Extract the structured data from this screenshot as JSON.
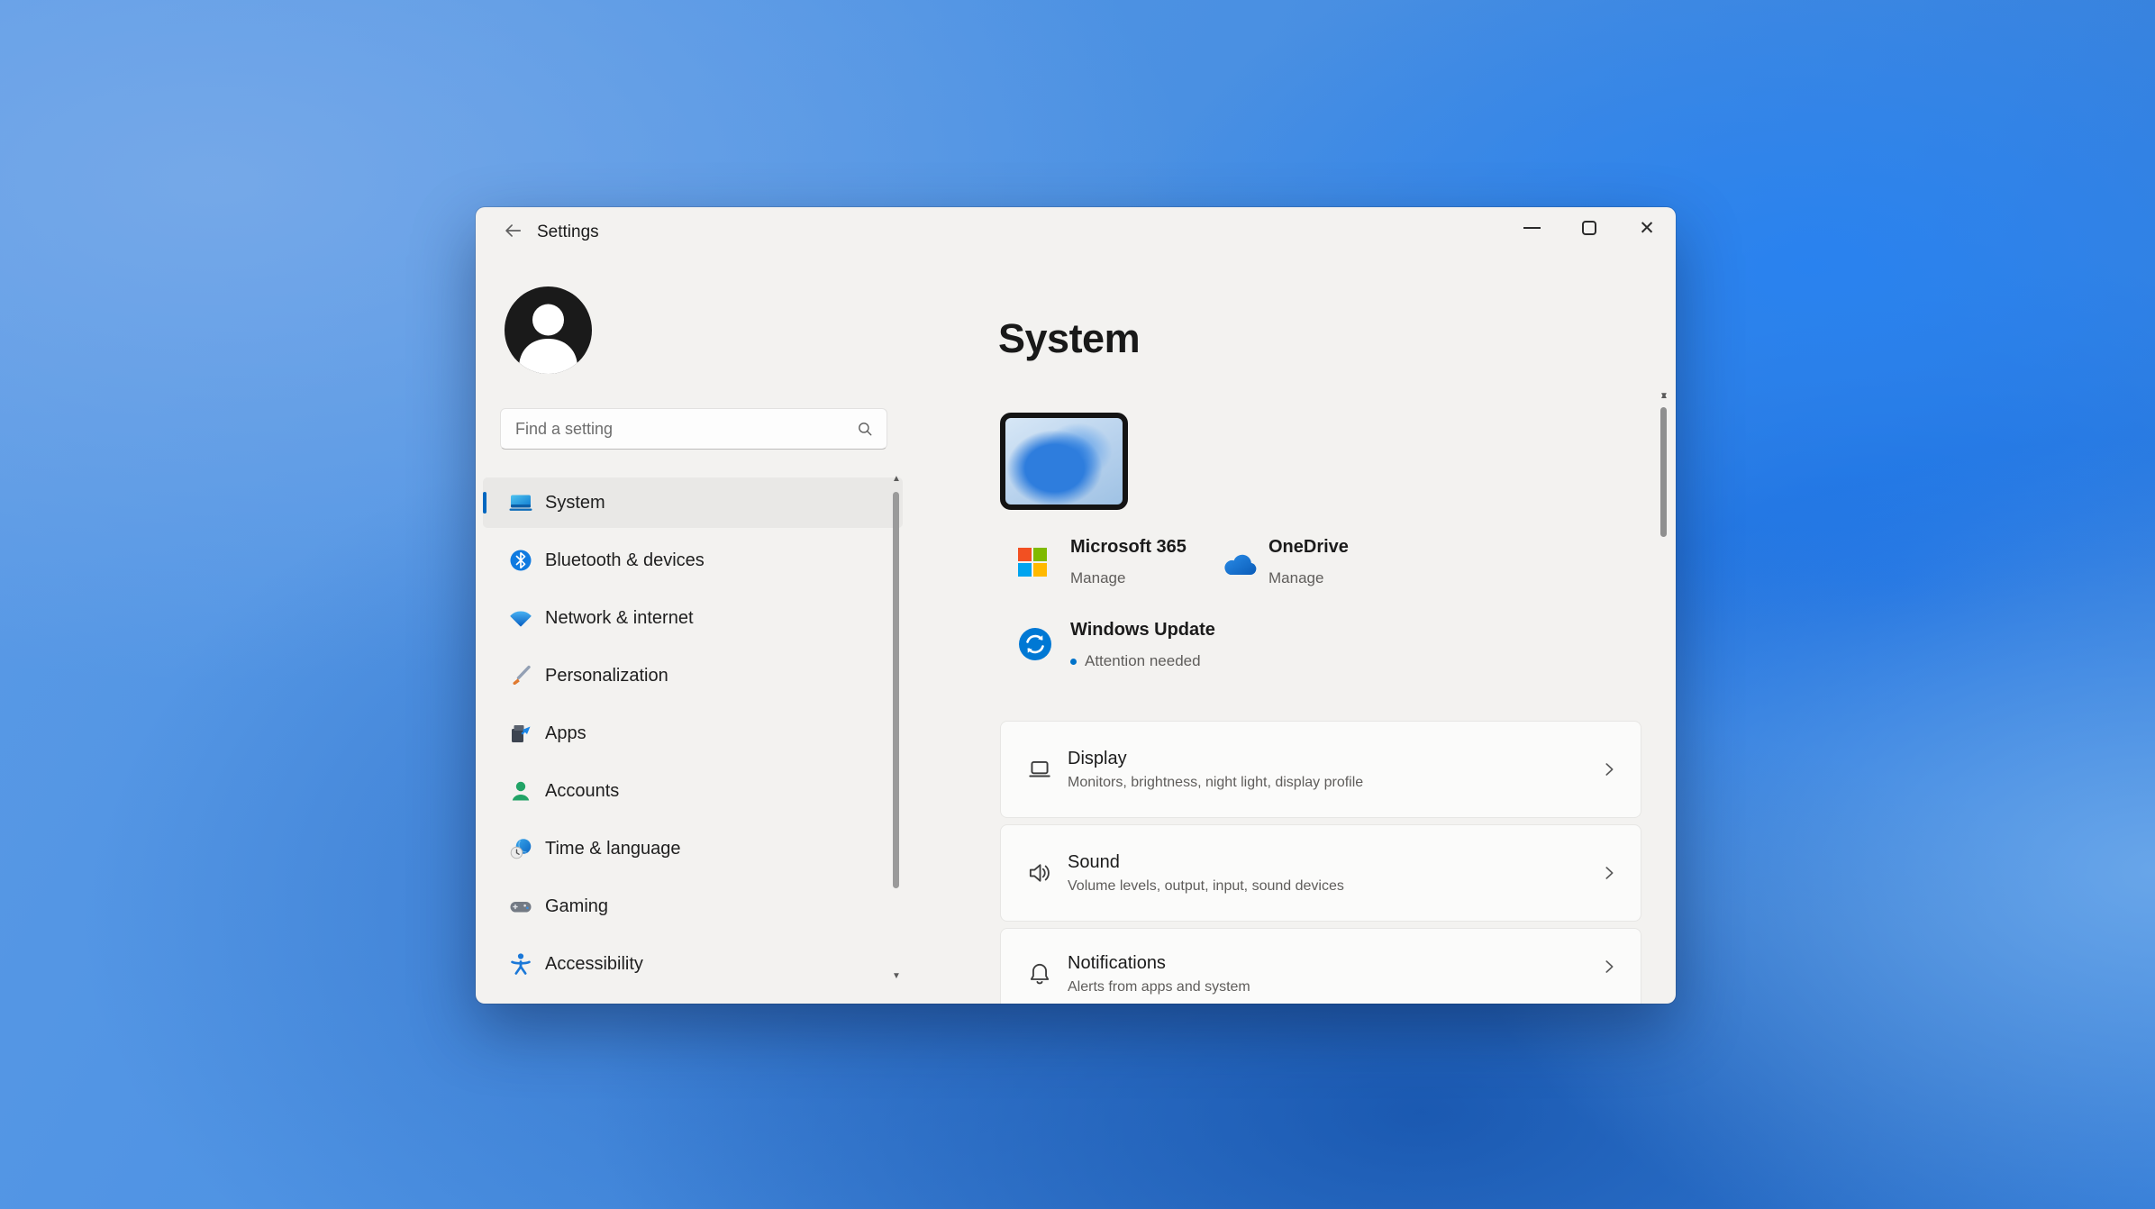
{
  "window": {
    "title": "Settings",
    "controls": {
      "minimize_icon": "minimize-icon",
      "maximize_icon": "maximize-icon",
      "close_icon": "close-icon"
    },
    "back_icon": "back-arrow-icon"
  },
  "colors": {
    "accent": "#0067c0",
    "windows_update_blue": "#0078d4",
    "selected_item_bg": "#e9e8e6",
    "window_bg": "#f3f2f0",
    "card_bg": "#fbfbfa",
    "ms_logo_red": "#f25022",
    "ms_logo_green": "#7fba00",
    "ms_logo_blue": "#00a4ef",
    "ms_logo_yellow": "#ffb900",
    "onedrive_blue": "#0f6cbd",
    "accounts_green": "#21a366"
  },
  "sidebar": {
    "avatar_icon": "user-avatar-icon",
    "search": {
      "placeholder": "Find a setting",
      "icon": "search-icon"
    },
    "items": [
      {
        "label": "System",
        "icon": "system-laptop-icon",
        "selected": true
      },
      {
        "label": "Bluetooth & devices",
        "icon": "bluetooth-icon",
        "selected": false
      },
      {
        "label": "Network & internet",
        "icon": "network-wifi-icon",
        "selected": false
      },
      {
        "label": "Personalization",
        "icon": "personalization-brush-icon",
        "selected": false
      },
      {
        "label": "Apps",
        "icon": "apps-icon",
        "selected": false
      },
      {
        "label": "Accounts",
        "icon": "accounts-person-icon",
        "selected": false
      },
      {
        "label": "Time & language",
        "icon": "time-language-icon",
        "selected": false
      },
      {
        "label": "Gaming",
        "icon": "gaming-controller-icon",
        "selected": false
      },
      {
        "label": "Accessibility",
        "icon": "accessibility-icon",
        "selected": false
      }
    ]
  },
  "main": {
    "heading": "System",
    "device_preview_icon": "device-wallpaper-thumbnail",
    "quick_links": [
      {
        "title": "Microsoft 365",
        "subtitle": "Manage",
        "icon": "microsoft-365-icon"
      },
      {
        "title": "OneDrive",
        "subtitle": "Manage",
        "icon": "onedrive-cloud-icon"
      },
      {
        "title": "Windows Update",
        "subtitle": "Attention needed",
        "icon": "windows-update-icon",
        "has_status_dot": true
      }
    ],
    "cards": [
      {
        "title": "Display",
        "subtitle": "Monitors, brightness, night light, display profile",
        "icon": "display-icon"
      },
      {
        "title": "Sound",
        "subtitle": "Volume levels, output, input, sound devices",
        "icon": "speaker-icon"
      },
      {
        "title": "Notifications",
        "subtitle": "Alerts from apps and system",
        "icon": "bell-icon"
      }
    ],
    "chevron_icon": "chevron-right-icon"
  }
}
